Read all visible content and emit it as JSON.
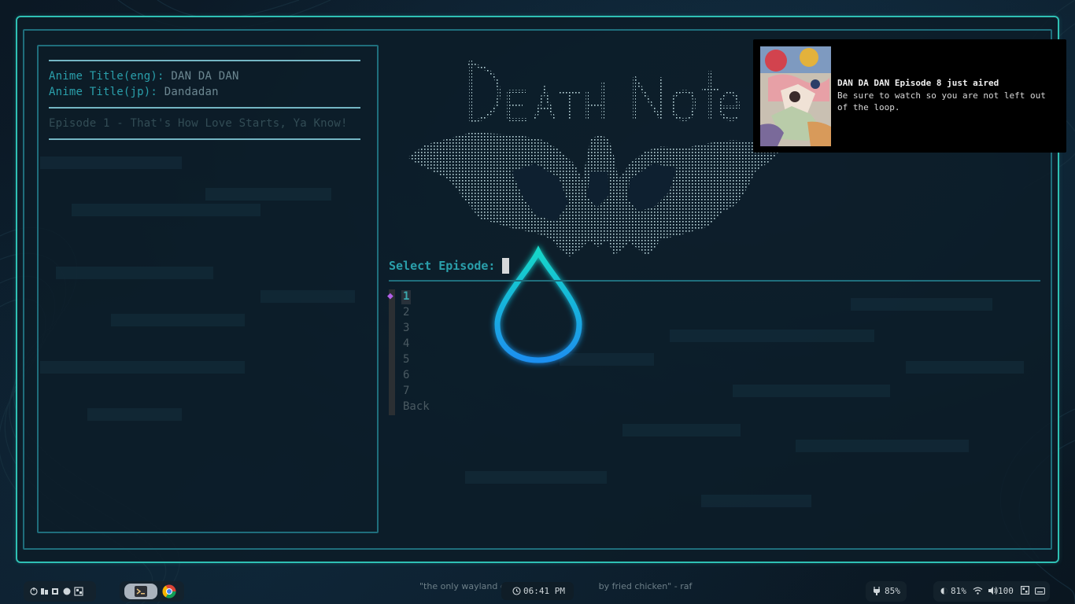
{
  "info": {
    "title_eng_label": "Anime Title(eng):",
    "title_eng_value": "DAN DA DAN",
    "title_jp_label": "Anime Title(jp):",
    "title_jp_value": "Dandadan",
    "episode_title": "Episode 1 - That's How Love Starts, Ya Know!"
  },
  "prompt": {
    "label": "Select Episode:"
  },
  "episodes": {
    "marker": "◆",
    "items": [
      "1",
      "2",
      "3",
      "4",
      "5",
      "6",
      "7",
      "Back"
    ],
    "selected": "1"
  },
  "notification": {
    "title": "DAN DA DAN Episode 8 just aired",
    "body": "Be sure to watch so you are not left out of the loop."
  },
  "taskbar": {
    "quote": "\"the only wayland co",
    "quote_tail": "by fried chicken\" - raf",
    "clock": "06:41 PM",
    "battery": "85%",
    "brightness": "81%",
    "volume": "100"
  },
  "colors": {
    "accent": "#2fc0b4",
    "label": "#2a9fab",
    "marker": "#b25fe8",
    "background": "#0c1a26"
  }
}
